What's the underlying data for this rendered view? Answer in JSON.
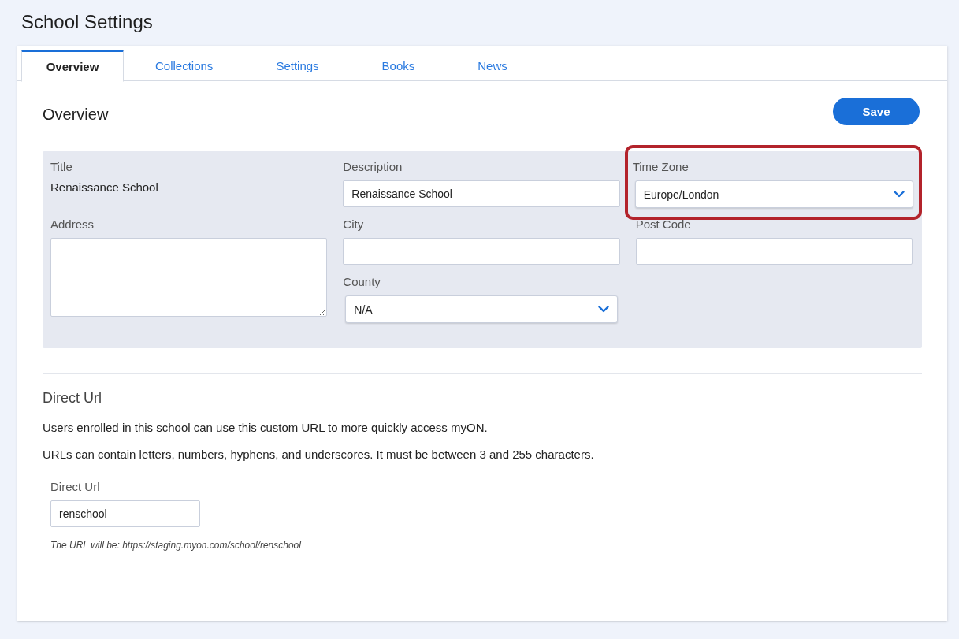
{
  "page_title": "School Settings",
  "tabs": [
    {
      "label": "Overview",
      "selected": true
    },
    {
      "label": "Collections",
      "selected": false
    },
    {
      "label": "Settings",
      "selected": false
    },
    {
      "label": "Books",
      "selected": false
    },
    {
      "label": "News",
      "selected": false
    }
  ],
  "section_title": "Overview",
  "save_button": "Save",
  "fields": [
    {
      "kind": "static",
      "label": "Title",
      "value": "Renaissance School",
      "highlighted": false
    },
    {
      "kind": "input",
      "label": "Description",
      "value": "Renaissance School",
      "highlighted": false
    },
    {
      "kind": "select",
      "label": "Time Zone",
      "value": "Europe/London",
      "highlighted": true
    },
    {
      "kind": "textarea",
      "label": "Address",
      "highlighted": false
    },
    {
      "kind": "input",
      "label": "City",
      "highlighted": false
    },
    {
      "kind": "input",
      "label": "Post Code",
      "highlighted": false
    },
    {
      "kind": "select",
      "label": "County",
      "value": "N/A",
      "highlighted": false
    }
  ],
  "direct_url": {
    "heading": "Direct Url",
    "paragraphs": [
      "Users enrolled in this school can use this custom URL to more quickly access myON.",
      "URLs can contain letters, numbers, hyphens, and underscores. It must be between 3 and 255 characters."
    ],
    "label": "Direct Url",
    "value": "renschool",
    "hint": "The URL will be: https://staging.myon.com/school/renschool"
  }
}
